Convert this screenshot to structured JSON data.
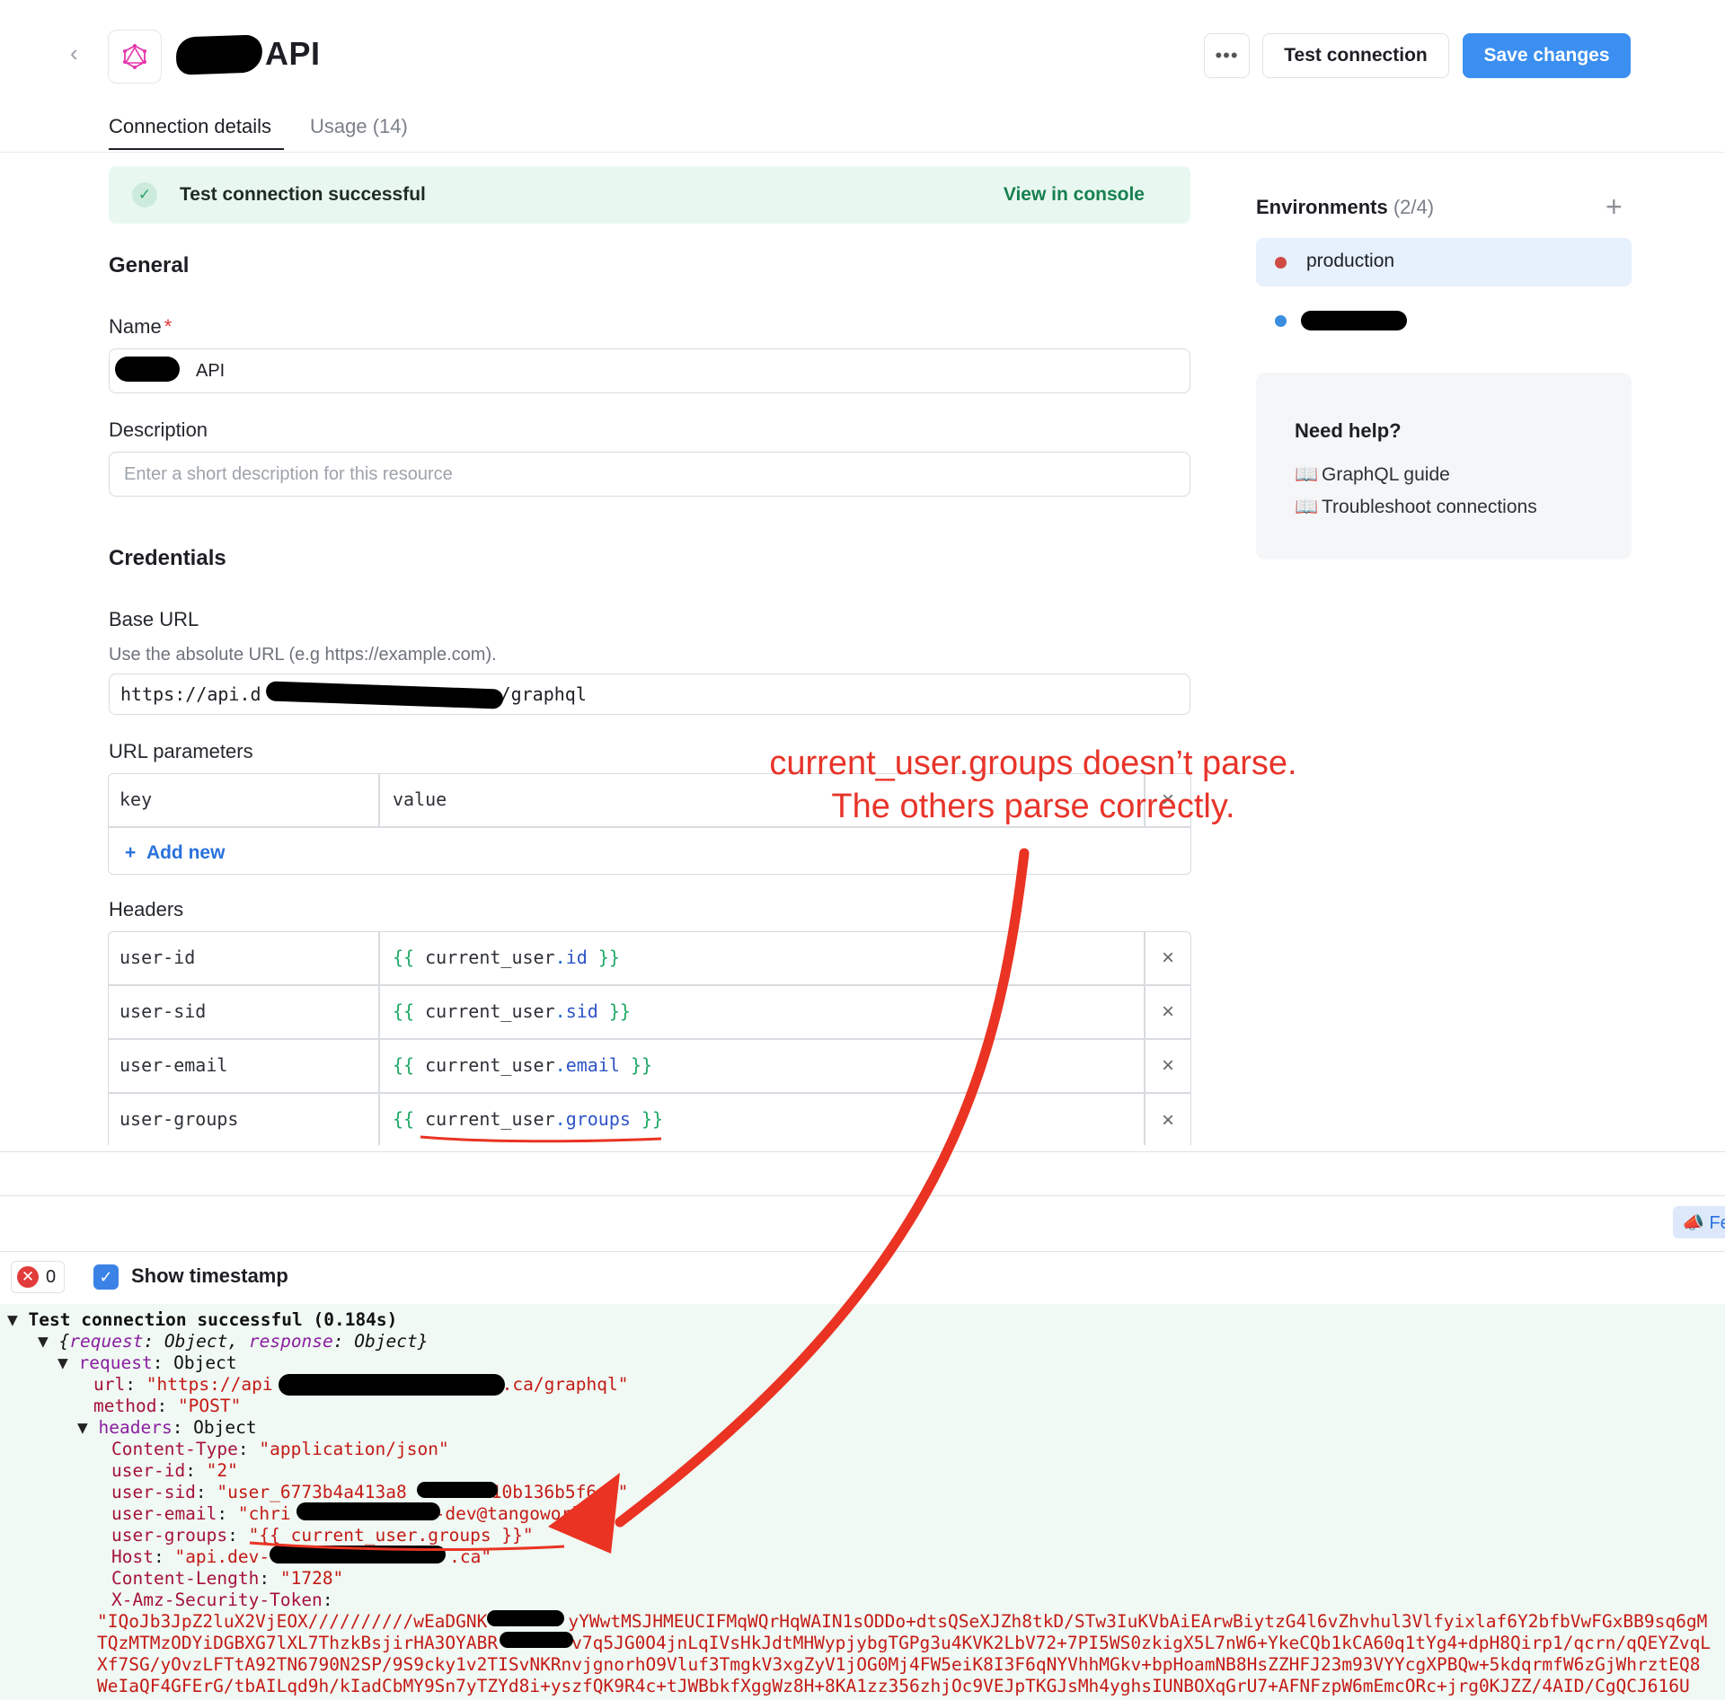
{
  "header": {
    "title_suffix": "API",
    "more_label": "•••",
    "test_label": "Test connection",
    "save_label": "Save changes"
  },
  "tabs": [
    {
      "label": "Connection details",
      "active": true
    },
    {
      "label": "Usage (14)",
      "active": false
    }
  ],
  "banner": {
    "text": "Test connection successful",
    "link": "View in console"
  },
  "general": {
    "heading": "General",
    "name_label": "Name",
    "name_required": "*",
    "name_value": "API",
    "description_label": "Description",
    "description_placeholder": "Enter a short description for this resource"
  },
  "credentials": {
    "heading": "Credentials",
    "base_url_label": "Base URL",
    "base_url_hint": "Use the absolute URL (e.g https://example.com).",
    "base_url_prefix": "https://api.d",
    "base_url_suffix": "/graphql"
  },
  "url_params": {
    "label": "URL parameters",
    "key_placeholder": "key",
    "value_placeholder": "value",
    "add_new": "Add new"
  },
  "headers": {
    "label": "Headers",
    "rows": [
      {
        "key": "user-id",
        "open": "{{",
        "obj": "current_user",
        "dot": ".",
        "prop": "id",
        "close": "}}"
      },
      {
        "key": "user-sid",
        "open": "{{",
        "obj": "current_user",
        "dot": ".",
        "prop": "sid",
        "close": "}}"
      },
      {
        "key": "user-email",
        "open": "{{",
        "obj": "current_user",
        "dot": ".",
        "prop": "email",
        "close": "}}"
      },
      {
        "key": "user-groups",
        "open": "{{",
        "obj": "current_user",
        "dot": ".",
        "prop": "groups",
        "close": "}}"
      }
    ]
  },
  "environments": {
    "title": "Environments",
    "count": "(2/4)",
    "items": [
      {
        "label": "production",
        "color": "#d04b45",
        "active": true
      },
      {
        "label": "",
        "color": "#3a8ee0",
        "active": false
      }
    ]
  },
  "help": {
    "title": "Need help?",
    "links": [
      "GraphQL guide",
      "Troubleshoot connections"
    ]
  },
  "annotation": {
    "line1": "current_user.groups doesn’t parse.",
    "line2": "The others parse correctly."
  },
  "console": {
    "error_count": "0",
    "show_timestamp": "Show timestamp",
    "feedback_fragment": "Fe",
    "summary": "Test connection successful (0.184s)",
    "object_line": {
      "open": "{",
      "k1": "request",
      "v1": "Object",
      "k2": "response",
      "v2": "Object",
      "close": "}"
    },
    "request_key": "request",
    "request_val": "Object",
    "url_key": "url",
    "url_prefix": "\"https://api",
    "url_suffix": ".ca/graphql\"",
    "method_key": "method",
    "method_val": "\"POST\"",
    "headers_key": "headers",
    "headers_val": "Object",
    "content_type_key": "Content-Type",
    "content_type_val": "\"application/json\"",
    "user_id_key": "user-id",
    "user_id_val": "\"2\"",
    "user_sid_key": "user-sid",
    "user_sid_prefix": "\"user_6773b4a413a8",
    "user_sid_suffix": "10b136b5f6d0\"",
    "user_email_key": "user-email",
    "user_email_prefix": "\"chri",
    "user_email_suffix": "-dev@tangowork",
    "user_groups_key": "user-groups",
    "user_groups_val": "\"{{ current_user.groups }}\"",
    "host_key": "Host",
    "host_prefix": "\"api.dev-",
    "host_suffix": ".ca\"",
    "content_length_key": "Content-Length",
    "content_length_val": "\"1728\"",
    "token_key": "X-Amz-Security-Token",
    "token_lines": [
      "\"IQoJb3JpZ2luX2VjEOX//////////wEaDGNK",
      "TQzMTMzODYiDGBXG7lXL7ThzkBsjirHA3OYABR",
      "Xf7SG/yOvzLFTtA92TN6790N2SP/9S9cky1v2TISvNKRnvjgnorhO9Vluf3TmgkV3xgZyV1jOG0Mj4FW5eiK8I3F6qNYVhhMGkv+bpHoamNB8HsZZHFJ23m93VYYcgXPBQw+5kdqrmfW6zGjWhrztEQ8",
      "WeIaQF4GFErG/tbAILqd9h/kIadCbMY9Sn7yTZYd8i+yszfQK9R4c+tJWBbkfXggWz8H+8KA1zz356zhjOc9VEJpTKGJsMh4yghsIUNBOXqGrU7+AFNFzpW6mEmcORc+jrg0KJZZ/4AID/CgQCJ616U"
    ],
    "token_tail_1": "yYWwtMSJHMEUCIFMqWQrHqWAIN1sODDo+dtsQSeXJZh8tkD/STw3IuKVbAiEArwBiytzG4l6vZhvhul3Vlfyixlaf6Y2bfbVwFGxBB9sq6gM",
    "token_tail_2": "v7q5JG0O4jnLqIVsHkJdtMHWypjybgTGPg3u4KVK2LbV72+7PI5WS0zkigX5L7nW6+YkeCQb1kCA60q1tYg4+dpH8Qirp1/qcrn/qQEYZvqL"
  }
}
